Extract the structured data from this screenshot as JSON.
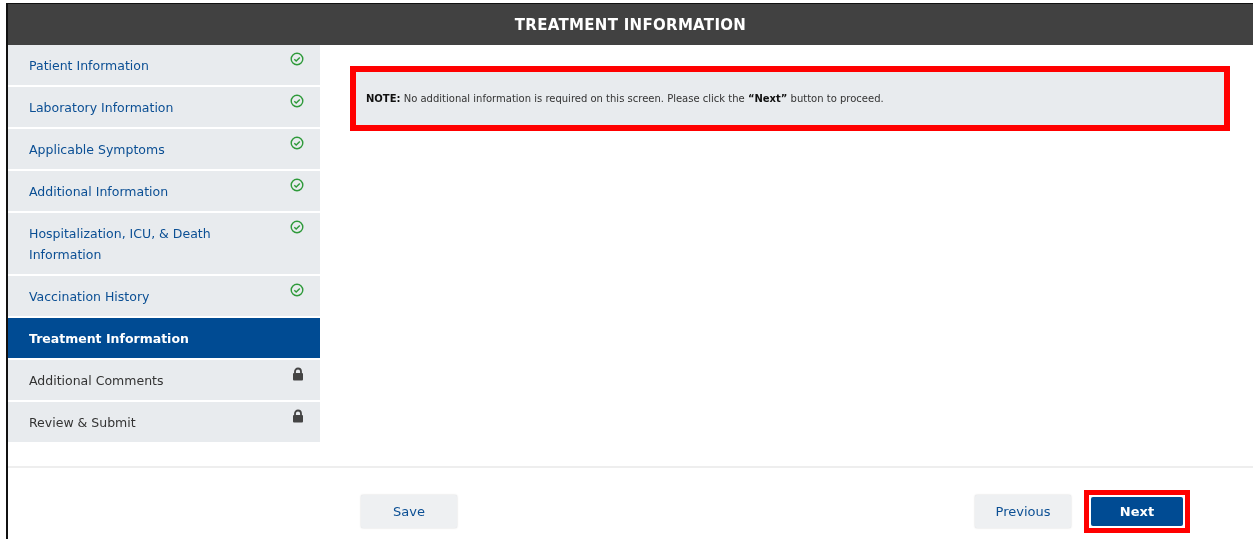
{
  "header": {
    "title": "TREATMENT INFORMATION"
  },
  "sidebar": {
    "items": [
      {
        "label": "Patient Information",
        "kind": "complete",
        "selected": false
      },
      {
        "label": "Laboratory Information",
        "kind": "complete",
        "selected": false
      },
      {
        "label": "Applicable Symptoms",
        "kind": "complete",
        "selected": false
      },
      {
        "label": "Additional Information",
        "kind": "complete",
        "selected": false
      },
      {
        "label": "Hospitalization, ICU, & Death Information",
        "kind": "complete",
        "selected": false
      },
      {
        "label": "Vaccination History",
        "kind": "complete",
        "selected": false
      },
      {
        "label": "Treatment Information",
        "kind": "current",
        "selected": true
      },
      {
        "label": "Additional Comments",
        "kind": "locked",
        "selected": false
      },
      {
        "label": "Review & Submit",
        "kind": "locked",
        "selected": false
      }
    ]
  },
  "note": {
    "text": "**NOTE:** No additional information is required on this screen. Please click the **“Next”** button to proceed.",
    "highlighted": true
  },
  "footer": {
    "buttons": [
      {
        "label": "Save",
        "kind": "secondary",
        "highlighted": false
      },
      {
        "label": "Previous",
        "kind": "secondary",
        "highlighted": false
      },
      {
        "label": "Next",
        "kind": "primary",
        "highlighted": true
      }
    ]
  }
}
